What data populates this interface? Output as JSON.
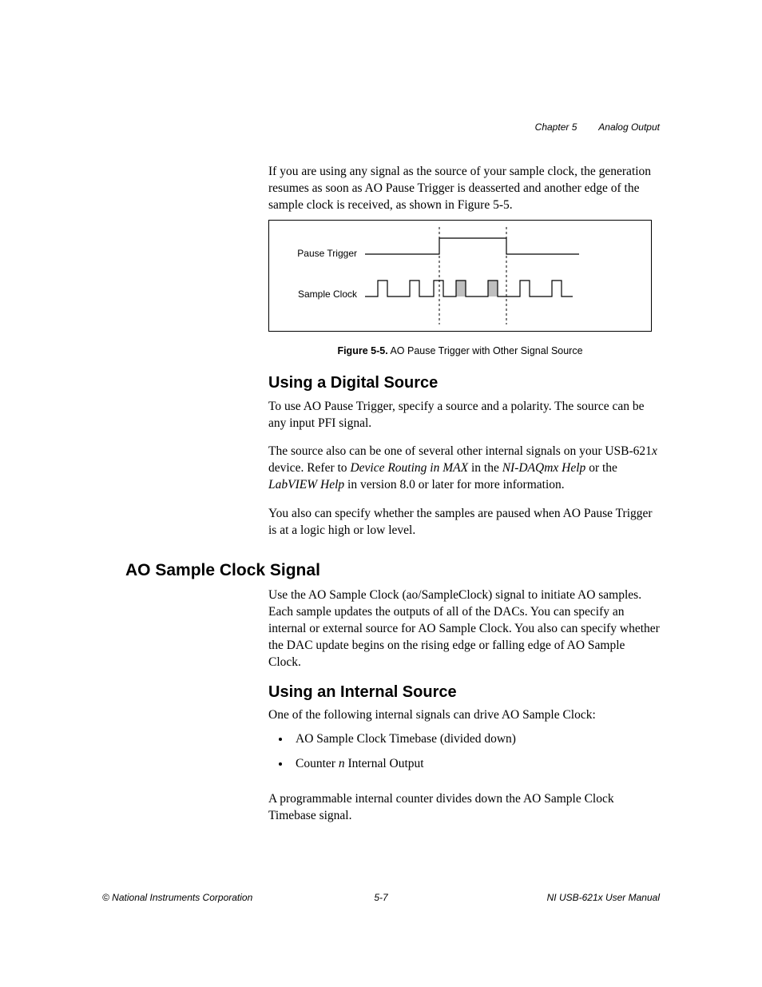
{
  "header": {
    "chapter": "Chapter 5",
    "title": "Analog Output"
  },
  "intro_para": "If you are using any signal as the source of your sample clock, the generation resumes as soon as AO Pause Trigger is deasserted and another edge of the sample clock is received, as shown in Figure 5-5.",
  "figure": {
    "label_pause": "Pause Trigger",
    "label_clock": "Sample Clock",
    "caption_bold": "Figure 5-5.",
    "caption_rest": "  AO Pause Trigger with Other Signal Source"
  },
  "sec_digital": {
    "heading": "Using a Digital Source",
    "p1": "To use AO Pause Trigger, specify a source and a polarity. The source can be any input PFI signal.",
    "p2_a": "The source also can be one of several other internal signals on your USB-621",
    "p2_x": "x",
    "p2_b": " device. Refer to ",
    "p2_i1": "Device Routing in MAX",
    "p2_c": " in the ",
    "p2_i2": "NI-DAQmx Help",
    "p2_d": " or the ",
    "p2_i3": "LabVIEW Help",
    "p2_e": " in version 8.0 or later for more information.",
    "p3": "You also can specify whether the samples are paused when AO Pause Trigger is at a logic high or low level."
  },
  "sec_sample": {
    "heading": "AO Sample Clock Signal",
    "p1": "Use the AO Sample Clock (ao/SampleClock) signal to initiate AO samples. Each sample updates the outputs of all of the DACs. You can specify an internal or external source for AO Sample Clock. You also can specify whether the DAC update begins on the rising edge or falling edge of AO Sample Clock."
  },
  "sec_internal": {
    "heading": "Using an Internal Source",
    "p1": "One of the following internal signals can drive AO Sample Clock:",
    "bullet1": "AO Sample Clock Timebase (divided down)",
    "bullet2_a": "Counter ",
    "bullet2_n": "n",
    "bullet2_b": " Internal Output",
    "p2": "A programmable internal counter divides down the AO Sample Clock Timebase signal."
  },
  "footer": {
    "left": "© National Instruments Corporation",
    "center": "5-7",
    "right": "NI USB-621x User Manual"
  }
}
